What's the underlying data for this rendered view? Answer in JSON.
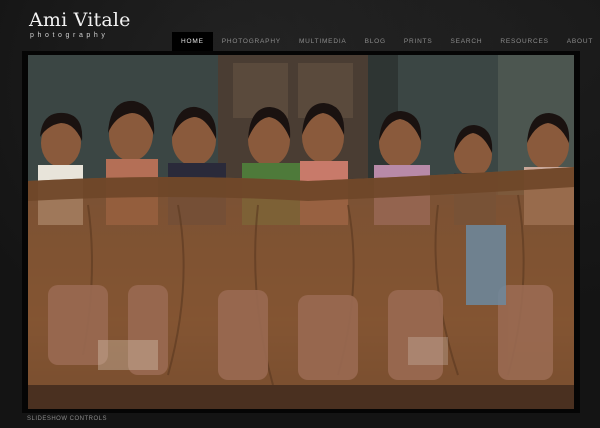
{
  "site": {
    "title": "Ami Vitale",
    "subtitle": "photography"
  },
  "nav": {
    "items": [
      {
        "label": "HOME",
        "active": true
      },
      {
        "label": "PHOTOGRAPHY",
        "active": false
      },
      {
        "label": "MULTIMEDIA",
        "active": false
      },
      {
        "label": "BLOG",
        "active": false
      },
      {
        "label": "PRINTS",
        "active": false
      },
      {
        "label": "SEARCH",
        "active": false
      },
      {
        "label": "RESOURCES",
        "active": false
      },
      {
        "label": "ABOUT",
        "active": false
      }
    ]
  },
  "slideshow": {
    "controls_label": "SLIDESHOW CONTROLS",
    "current_image": "group-of-girls-behind-cloth"
  },
  "colors": {
    "background": "#141414",
    "nav_active_bg": "#000000",
    "nav_text": "#8c8c8c",
    "logo_text": "#f2f2f2"
  }
}
